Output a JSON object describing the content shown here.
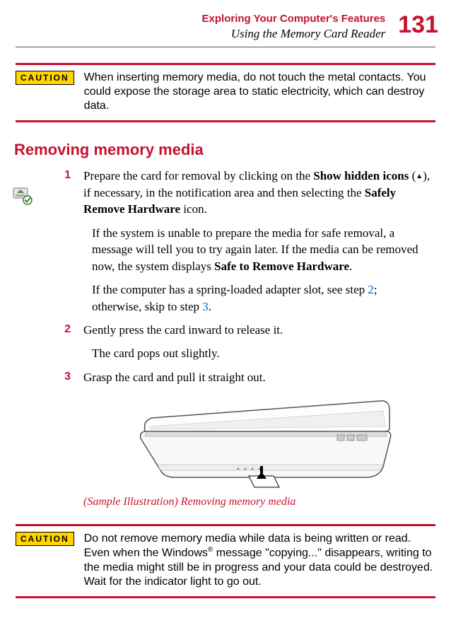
{
  "header": {
    "chapter": "Exploring Your Computer's Features",
    "section": "Using the Memory Card Reader",
    "page_number": "131"
  },
  "caution1": {
    "label": "CAUTION",
    "text": "When inserting memory media, do not touch the metal contacts. You could expose the storage area to static electricity, which can destroy data."
  },
  "heading": "Removing memory media",
  "steps": {
    "s1": {
      "num": "1",
      "part1": "Prepare the card for removal by clicking on the ",
      "bold1": "Show hidden icons",
      "part2": " (",
      "arrow": "▲",
      "part3": "), if necessary, in the notification area and then selecting the ",
      "bold2": "Safely Remove Hardware",
      "part4": " icon."
    },
    "s1_cont1": {
      "part1": "If the system is unable to prepare the media for safe removal, a message will tell you to try again later. If the media can be removed now, the system displays ",
      "bold1": "Safe to Remove Hardware",
      "part2": "."
    },
    "s1_cont2": {
      "part1": "If the computer has a spring-loaded adapter slot, see step ",
      "link1": "2",
      "part2": "; otherwise, skip to step ",
      "link2": "3",
      "part3": "."
    },
    "s2": {
      "num": "2",
      "text": "Gently press the card inward to release it."
    },
    "s2_cont": "The card pops out slightly.",
    "s3": {
      "num": "3",
      "text": "Grasp the card and pull it straight out."
    }
  },
  "illustration_caption": "(Sample Illustration) Removing memory media",
  "caution2": {
    "label": "CAUTION",
    "part1": "Do not remove memory media while data is being written or read. Even when the Windows",
    "reg": "®",
    "part2": " message \"copying...\" disappears, writing to the media might still be in progress and your data could be destroyed. Wait for the indicator light to go out."
  }
}
